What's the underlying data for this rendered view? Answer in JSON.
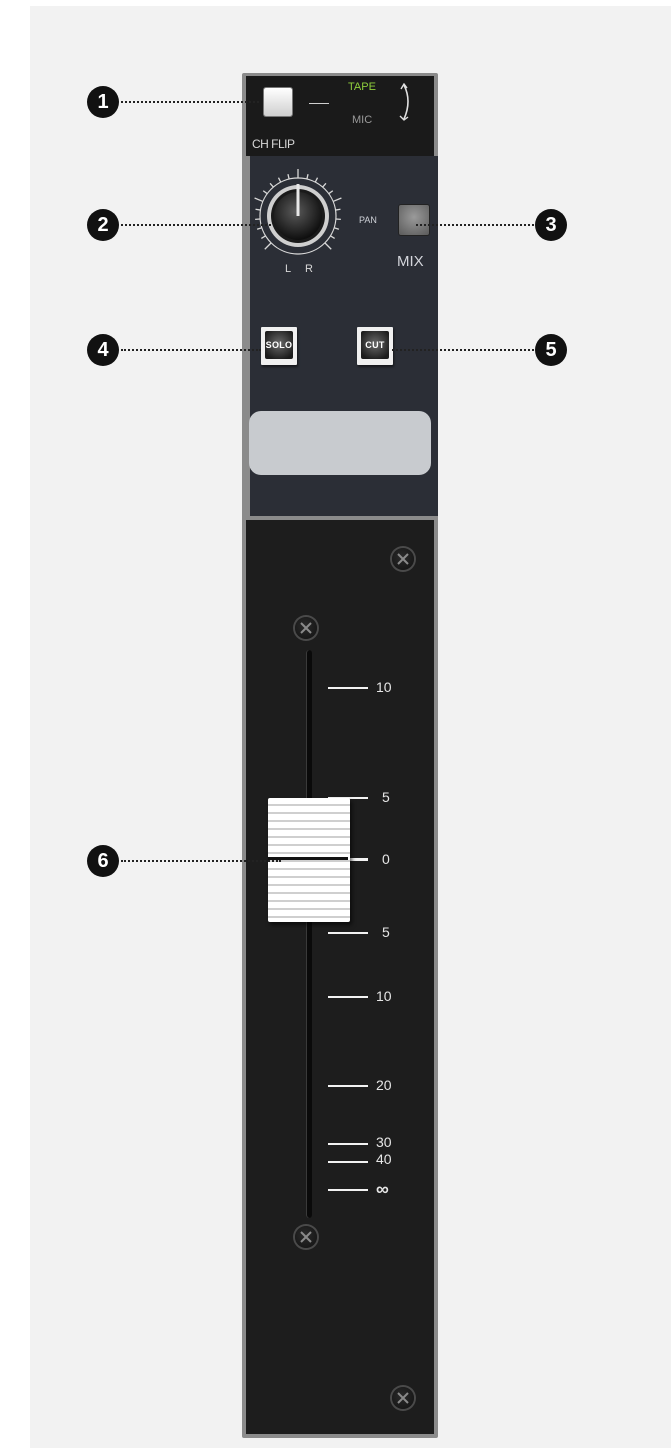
{
  "strip": {
    "ch_flip_label": "CH FLIP",
    "tape_label": "TAPE",
    "mic_label": "MIC",
    "knob_left_label": "L",
    "knob_right_label": "R",
    "pan_label": "PAN",
    "mix_label": "MIX",
    "solo_label": "SOLO",
    "cut_label": "CUT",
    "scale_labels": [
      "10",
      "5",
      "0",
      "5",
      "10",
      "20",
      "30",
      "40",
      "∞"
    ]
  },
  "callouts": [
    "1",
    "2",
    "3",
    "4",
    "5",
    "6"
  ],
  "colors": {
    "tape_green": "#8fcf3c",
    "strip_panel": "#2b2e36",
    "fader_panel": "#1d1d1d"
  }
}
